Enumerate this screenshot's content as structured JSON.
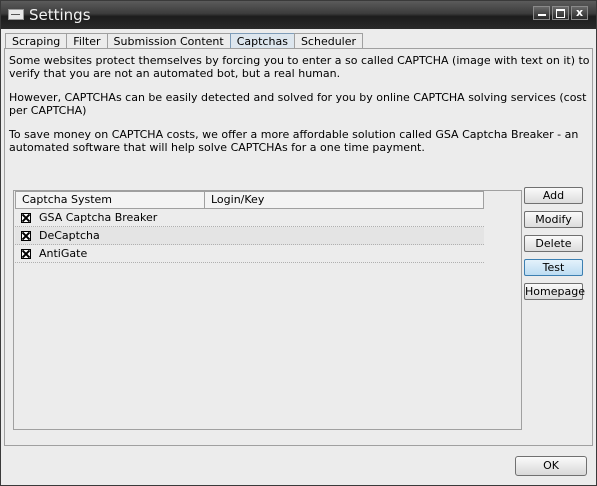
{
  "window": {
    "title": "Settings",
    "close_glyph": "x"
  },
  "tabs": [
    {
      "label": "Scraping",
      "active": false
    },
    {
      "label": "Filter",
      "active": false
    },
    {
      "label": "Submission Content",
      "active": false
    },
    {
      "label": "Captchas",
      "active": true
    },
    {
      "label": "Scheduler",
      "active": false
    }
  ],
  "info": {
    "p1": "Some websites protect themselves by forcing you to enter a so called CAPTCHA (image with text on it) to verify that you are not an automated bot, but a real human.",
    "p2": "However, CAPTCHAs can be easily detected and solved for you by online CAPTCHA solving services (cost per CAPTCHA)",
    "p3": "To save money on CAPTCHA costs, we offer a more affordable solution called GSA Captcha Breaker - an automated software that will help solve CAPTCHAs for a one time payment."
  },
  "table": {
    "columns": [
      "Captcha System",
      "Login/Key"
    ],
    "rows": [
      {
        "name": "GSA Captcha Breaker",
        "key": "",
        "checked": true
      },
      {
        "name": "DeCaptcha",
        "key": "",
        "checked": true
      },
      {
        "name": "AntiGate",
        "key": "",
        "checked": true
      }
    ]
  },
  "buttons": {
    "add": "Add",
    "modify": "Modify",
    "delete": "Delete",
    "test": "Test",
    "homepage": "Homepage",
    "ok": "OK"
  },
  "colors": {
    "titlebar": "#2a2a2a",
    "active_tab": "#dde6ee",
    "focused_button": "#bcdcf2"
  }
}
